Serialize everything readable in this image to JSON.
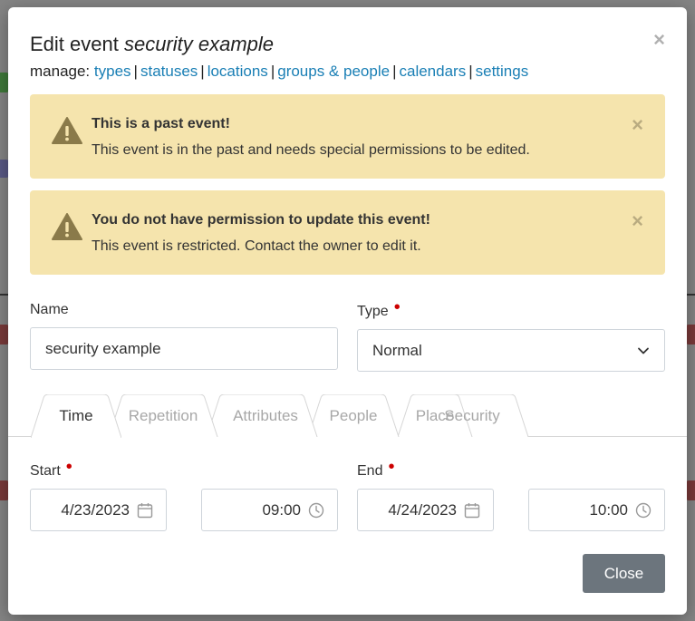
{
  "modal": {
    "title_prefix": "Edit event ",
    "title_event": "security example",
    "close_symbol": "×",
    "manage_label": "manage:",
    "manage_links": [
      "types",
      "statuses",
      "locations",
      "groups & people",
      "calendars",
      "settings"
    ],
    "link_color": "#1a7fb5"
  },
  "alerts": [
    {
      "title": "This is a past event!",
      "text": "This event is in the past and needs special permissions to be edited.",
      "icon": "warning-icon",
      "close": "×"
    },
    {
      "title": "You do not have permission to update this event!",
      "text": "This event is restricted. Contact the owner to edit it.",
      "icon": "warning-icon",
      "close": "×"
    }
  ],
  "form": {
    "name_label": "Name",
    "name_value": "security example",
    "type_label": "Type",
    "type_value": "Normal",
    "required_mark": "•"
  },
  "tabs": [
    {
      "label": "Time",
      "active": true
    },
    {
      "label": "Repetition",
      "active": false
    },
    {
      "label": "Attributes",
      "active": false
    },
    {
      "label": "People",
      "active": false
    },
    {
      "label": "Place",
      "active": false
    },
    {
      "label": "Security",
      "active": false
    }
  ],
  "time": {
    "start_label": "Start",
    "start_date": "4/23/2023",
    "start_time": "09:00",
    "end_label": "End",
    "end_date": "4/24/2023",
    "end_time": "10:00"
  },
  "footer": {
    "close_label": "Close",
    "close_color": "#6c757d"
  },
  "colors": {
    "alert_bg": "#f5e4ad",
    "required": "#cc0000"
  }
}
